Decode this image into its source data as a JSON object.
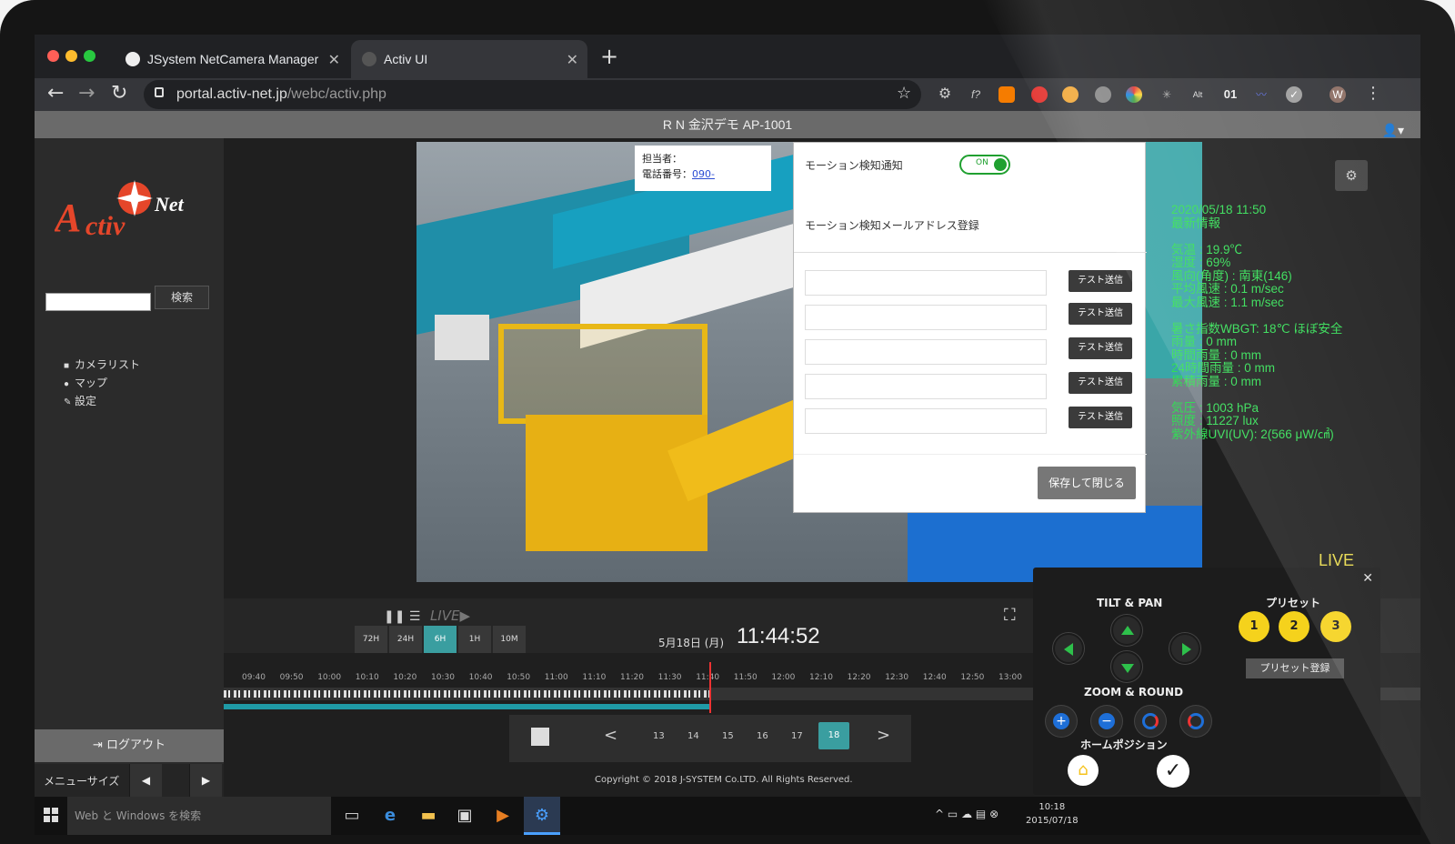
{
  "browser": {
    "tabs": [
      {
        "label": "JSystem NetCamera Manager"
      },
      {
        "label": "Activ UI"
      }
    ],
    "url_host": "portal.activ-net.jp",
    "url_path": "/webc/activ.php",
    "extensions": [
      "f?",
      "Alt",
      "01"
    ]
  },
  "header": {
    "title": "R N 金沢デモ AP-1001"
  },
  "sidebar": {
    "search_button": "検索",
    "items": [
      {
        "label": "カメラリスト"
      },
      {
        "label": "マップ"
      },
      {
        "label": "設定"
      }
    ],
    "logout": "ログアウト",
    "menu_size": "メニューサイズ"
  },
  "contact": {
    "person_label": "担当者：",
    "phone_label": "電話番号：",
    "phone": "090-"
  },
  "osd": {
    "time": "2020/05/18 11:50",
    "lines": [
      "2020/05/18 11:50",
      "最新情報",
      "",
      "気温 : 19.9℃",
      "湿度 : 69%",
      "風向(角度) : 南東(146)",
      "平均風速 : 0.1 m/sec",
      "最大風速 : 1.1 m/sec",
      "",
      "暑さ指数WBGT: 18℃ ほぼ安全",
      "雨量 : 0 mm",
      "時間雨量 : 0 mm",
      "24時間雨量 : 0 mm",
      "累積雨量 : 0 mm",
      "",
      "気圧 : 1003 hPa",
      "照度 : 11227 lux",
      "紫外線UVI(UV): 2(566 μW/㎠)"
    ]
  },
  "live_tag": "LIVE",
  "modal": {
    "notify_label": "モーション検知通知",
    "toggle": "ON",
    "register_label": "モーション検知メールアドレス登録",
    "send_buttons": [
      "テスト送信",
      "テスト送信",
      "テスト送信",
      "テスト送信",
      "テスト送信"
    ],
    "save": "保存して閉じる"
  },
  "timeline": {
    "live": "LIVE",
    "ranges": [
      "72H",
      "24H",
      "6H",
      "1H",
      "10M"
    ],
    "active_range": "6H",
    "date": "5月18日 (月)",
    "time": "11:44:52",
    "ticks": [
      "09:40",
      "09:50",
      "10:00",
      "10:10",
      "10:20",
      "10:30",
      "10:40",
      "10:50",
      "11:00",
      "11:10",
      "11:20",
      "11:30",
      "11:40",
      "11:50",
      "12:00",
      "12:10",
      "12:20",
      "12:30",
      "12:40",
      "12:50",
      "13:00"
    ],
    "days": [
      "13",
      "14",
      "15",
      "16",
      "17",
      "18"
    ],
    "active_day": "18",
    "copyright": "Copyright © 2018 J-SYSTEM Co.LTD. All Rights Reserved."
  },
  "ptz": {
    "tilt_pan": "TILT & PAN",
    "preset": "プリセット",
    "presets": [
      "1",
      "2",
      "3"
    ],
    "preset_register": "プリセット登録",
    "zoom_round": "ZOOM & ROUND",
    "home_position": "ホームポジション"
  },
  "taskbar": {
    "search": "Web と Windows を検索",
    "time": "10:18",
    "date": "2015/07/18"
  },
  "colors": {
    "accent": "#3a9ea0",
    "osd": "#33dd55",
    "preset": "#f5d21c"
  }
}
